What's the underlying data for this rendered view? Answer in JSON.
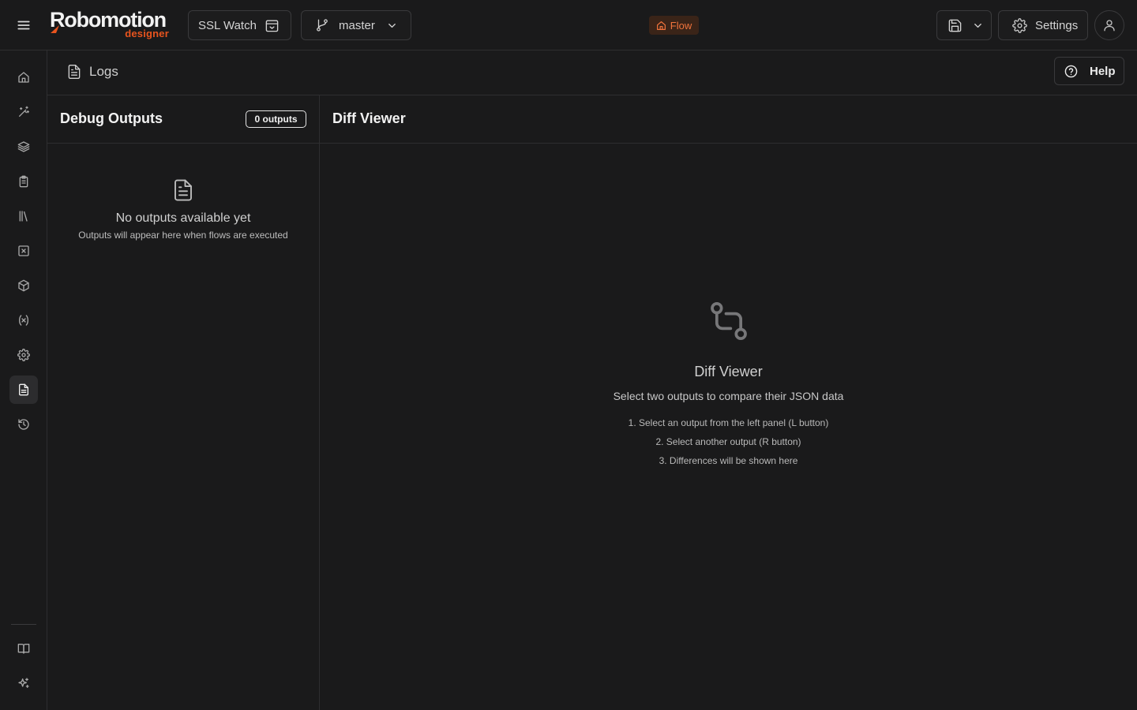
{
  "app": {
    "logo_main": "Robomotion",
    "logo_sub": "designer"
  },
  "topbar": {
    "project_name": "SSL Watch",
    "branch": "master",
    "flow_badge": "Flow",
    "settings_label": "Settings"
  },
  "page": {
    "title": "Logs",
    "help_label": "Help"
  },
  "outputs": {
    "title": "Debug Outputs",
    "count_badge": "0 outputs",
    "empty_title": "No outputs available yet",
    "empty_subtitle": "Outputs will appear here when flows are executed"
  },
  "diff": {
    "title": "Diff Viewer",
    "empty_title": "Diff Viewer",
    "empty_subtitle": "Select two outputs to compare their JSON data",
    "steps": [
      "1. Select an output from the left panel (L button)",
      "2. Select another output (R button)",
      "3. Differences will be shown here"
    ]
  },
  "sidebar": {
    "items": [
      {
        "icon": "home-icon"
      },
      {
        "icon": "magic-wand-icon"
      },
      {
        "icon": "layers-icon"
      },
      {
        "icon": "clipboard-icon"
      },
      {
        "icon": "library-icon"
      },
      {
        "icon": "square-x-icon"
      },
      {
        "icon": "package-icon"
      },
      {
        "icon": "variable-icon"
      },
      {
        "icon": "gear-icon"
      },
      {
        "icon": "file-text-icon",
        "active": true
      },
      {
        "icon": "history-icon"
      }
    ],
    "bottom_items": [
      {
        "icon": "book-open-icon"
      },
      {
        "icon": "sparkles-icon"
      }
    ]
  },
  "colors": {
    "background": "#1a1a1b",
    "accent": "#e8541e",
    "flow_badge_text": "#f0733c",
    "border": "#2e2e30"
  }
}
